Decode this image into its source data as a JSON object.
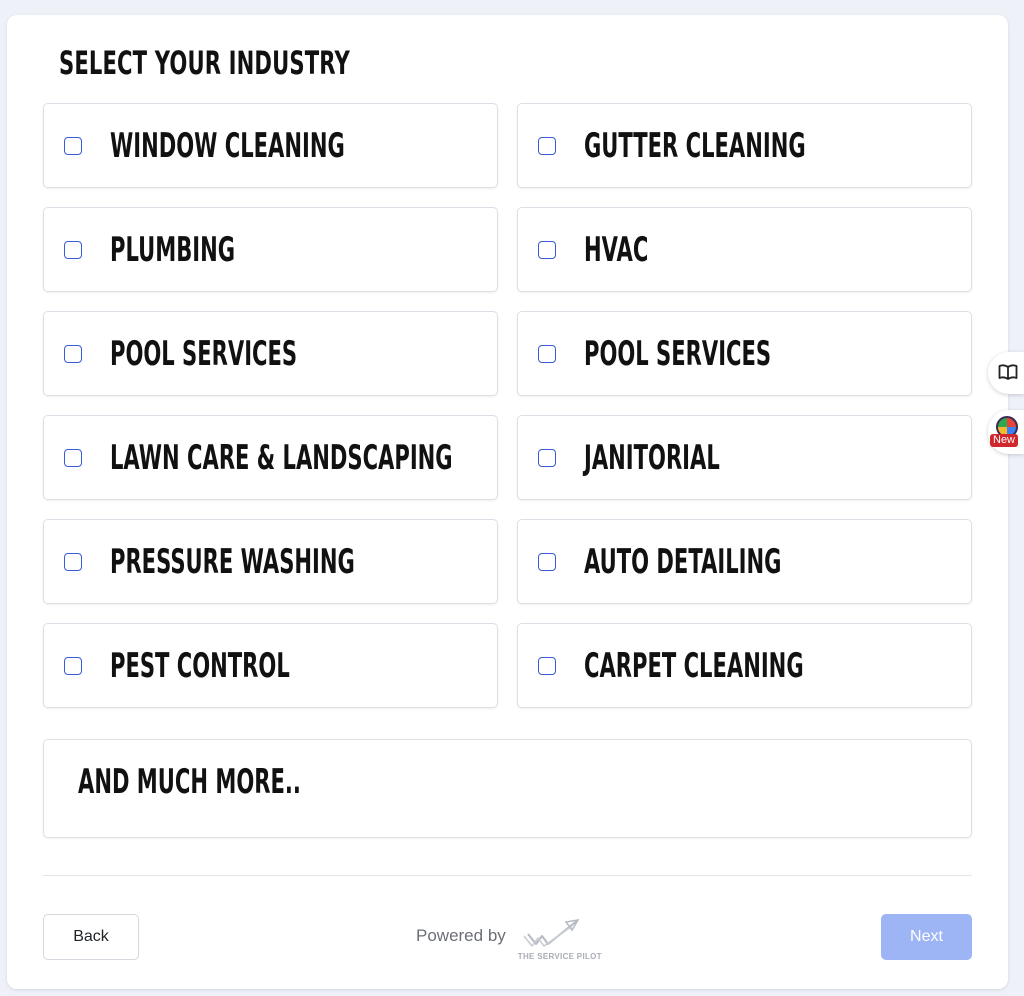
{
  "header": {
    "title": "SELECT YOUR INDUSTRY"
  },
  "industries": [
    {
      "label": "WINDOW CLEANING",
      "checked": false
    },
    {
      "label": "GUTTER CLEANING",
      "checked": false
    },
    {
      "label": "PLUMBING",
      "checked": false
    },
    {
      "label": "HVAC",
      "checked": false
    },
    {
      "label": "POOL SERVICES",
      "checked": false
    },
    {
      "label": "POOL SERVICES",
      "checked": false
    },
    {
      "label": "LAWN CARE & LANDSCAPING",
      "checked": false
    },
    {
      "label": "JANITORIAL",
      "checked": false
    },
    {
      "label": "PRESSURE WASHING",
      "checked": false
    },
    {
      "label": "AUTO DETAILING",
      "checked": false
    },
    {
      "label": "PEST CONTROL",
      "checked": false
    },
    {
      "label": "CARPET CLEANING",
      "checked": false
    }
  ],
  "more": {
    "label": "AND MUCH MORE.."
  },
  "footer": {
    "back_label": "Back",
    "next_label": "Next",
    "powered_by": "Powered by",
    "logo_text": "THE SERVICE PILOT"
  },
  "side_widgets": {
    "new_badge": "New"
  },
  "colors": {
    "checkbox_border": "#3a5bd9",
    "next_button_bg": "#9db4f5",
    "new_badge_bg": "#d0272c"
  },
  "icons": {
    "book": "book-open-icon",
    "orb": "color-orb-icon",
    "logo": "paper-plane-logo-icon"
  }
}
